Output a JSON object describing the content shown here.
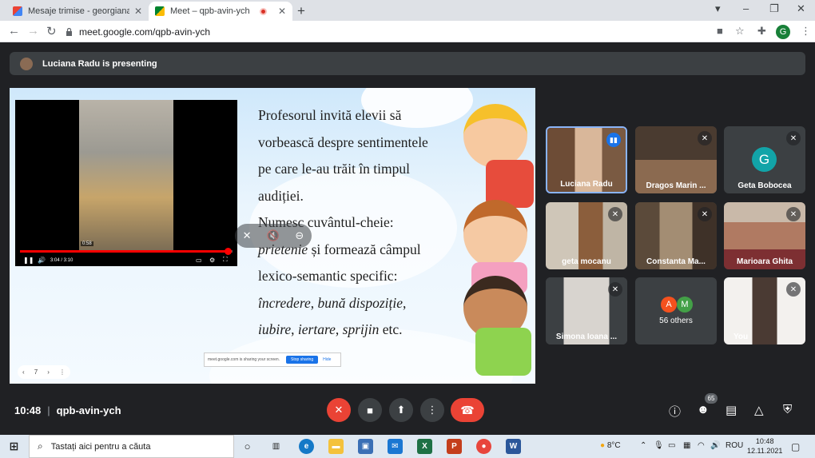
{
  "browser": {
    "tabs": [
      {
        "label": "Mesaje trimise - georgianapascu",
        "active": false
      },
      {
        "label": "Meet – qpb-avin-ych",
        "active": true
      }
    ],
    "new_tab": "+",
    "url": "meet.google.com/qpb-avin-ych",
    "profile_initial": "G",
    "window_controls": [
      "▾",
      "–",
      "❐",
      "✕"
    ]
  },
  "presenting_banner": "Luciana Radu is presenting",
  "slide": {
    "lines": [
      {
        "text": "Profesorul invită elevii să",
        "italic": false
      },
      {
        "text": "vorbească despre sentimentele",
        "italic": false
      },
      {
        "text": "pe care le-au trăit în timpul",
        "italic": false
      },
      {
        "text": "audiției.",
        "italic": false
      },
      {
        "text": "Numesc cuvântul-cheie:",
        "italic": false
      }
    ],
    "line6_italic": "prietenie",
    "line6_rest": " și formează câmpul",
    "line7": "lexico-semantic specific:",
    "line8_a": "încredere",
    "line8_b": ", ",
    "line8_c": "bună dispoziție",
    "line8_d": ",",
    "line9_a": "iubire",
    "line9_b": ", ",
    "line9_c": "iertare",
    "line9_d": ", ",
    "line9_e": "sprijin",
    "line9_f": " etc.",
    "video": {
      "time": "3:04 / 3:10",
      "tooltip": "0:58",
      "progress": 0.98
    },
    "share_bar": {
      "text": "meet.google.com is sharing your screen.",
      "stop": "Stop sharing",
      "hide": "Hide"
    },
    "pager": {
      "prev": "‹",
      "page": "7",
      "next": "›",
      "more": "⋮"
    }
  },
  "participants": [
    {
      "name": "Luciana Radu",
      "speaking": true,
      "muted": false
    },
    {
      "name": "Dragos Marin ...",
      "muted": true
    },
    {
      "name": "Geta Bobocea",
      "initial": "G",
      "muted": true
    },
    {
      "name": "geta mocanu",
      "muted": true
    },
    {
      "name": "Constanta Ma...",
      "muted": true
    },
    {
      "name": "Marioara Ghita",
      "muted": true
    },
    {
      "name": "Simona Ioana ...",
      "muted": true
    },
    {
      "name": "56 others",
      "initials": [
        "A",
        "M"
      ]
    },
    {
      "name": "You",
      "muted": true
    }
  ],
  "bottom": {
    "time": "10:48",
    "meeting_code": "qpb-avin-ych",
    "people_count": "65"
  },
  "taskbar": {
    "search_placeholder": "Tastați aici pentru a căuta",
    "weather": "8°C",
    "language": "ROU",
    "time": "10:48",
    "date": "12.11.2021"
  },
  "colors": {
    "accent": "#1a73e8",
    "danger": "#ea4335",
    "bg": "#202124",
    "tile": "#3c4043"
  }
}
